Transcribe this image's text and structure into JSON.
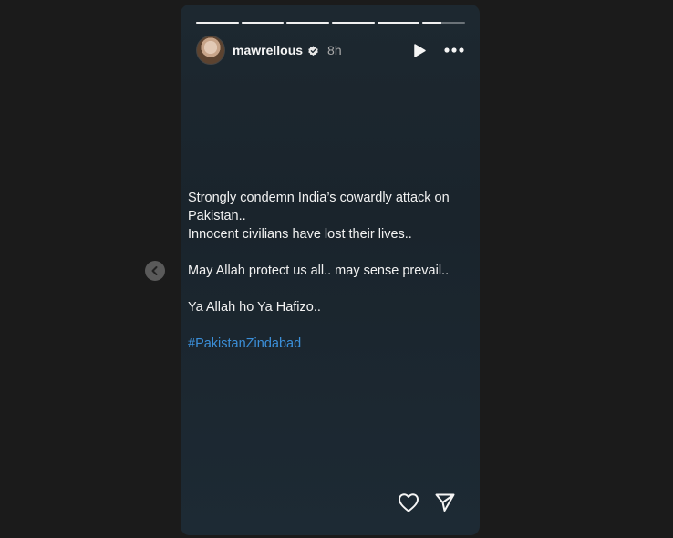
{
  "story": {
    "username": "mawrellous",
    "time": "8h",
    "progress": [
      1,
      1,
      1,
      1,
      1,
      0.45
    ],
    "caption": {
      "line1": "Strongly condemn India’s cowardly attack on Pakistan..",
      "line2": "Innocent civilians have lost their lives..",
      "line3": "May Allah protect us all.. may sense prevail..",
      "line4": "Ya Allah ho Ya Hafizo..",
      "hashtag": "#PakistanZindabad"
    },
    "icons": {
      "verified": "verified-badge-icon",
      "play": "play-icon",
      "more": "more-options-icon",
      "like": "heart-icon",
      "share": "send-icon",
      "previous": "chevron-left-icon"
    },
    "colors": {
      "hashtag": "#3b8fd9",
      "background": "#1b1b1b"
    }
  }
}
